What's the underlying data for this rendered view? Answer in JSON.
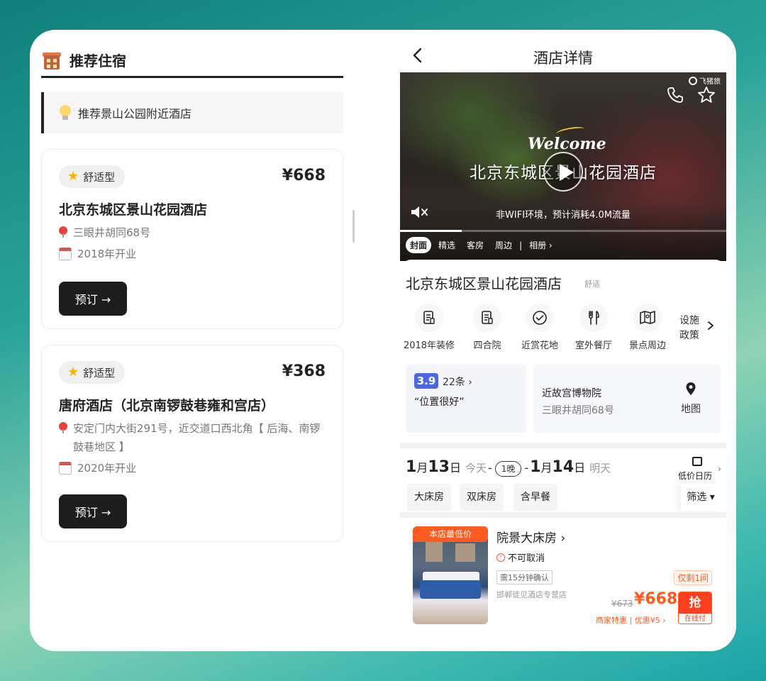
{
  "left": {
    "title": "推荐住宿",
    "tip": "推荐景山公园附近酒店",
    "cards": [
      {
        "tag": "舒适型",
        "price": "¥668",
        "name": "北京东城区景山花园酒店",
        "address": "三眼井胡同68号",
        "opened": "2018年开业",
        "book": "预订 →"
      },
      {
        "tag": "舒适型",
        "price": "¥368",
        "name": "唐府酒店（北京南锣鼓巷雍和宫店）",
        "address": "安定门内大街291号，近交道口西北角【 后海、南锣鼓巷地区 】",
        "opened": "2020年开业",
        "book": "预订 →"
      }
    ]
  },
  "right": {
    "title": "酒店详情",
    "video": {
      "brand": "飞猪旅",
      "welcome": "Welcome",
      "overlay_name": "北京东城区景山花园酒店",
      "wifi_note": "非WIFI环境，预计消耗4.0M流量",
      "progress": 0.19,
      "tabs": [
        "封面",
        "精选",
        "客房",
        "周边"
      ],
      "album": "相册 ›"
    },
    "hotel_name": "北京东城区景山花园酒店",
    "level": "舒适",
    "facilities": [
      "2018年装修",
      "四合院",
      "近赏花地",
      "室外餐厅",
      "景点周边"
    ],
    "policy": "设施政策",
    "review": {
      "score": "3.9",
      "count": "22条 ›",
      "quote": "“位置很好”"
    },
    "location": {
      "name": "近故宫博物院",
      "address": "三眼井胡同68号",
      "map": "地图"
    },
    "dates": {
      "checkin_month": "1",
      "checkin_day": "13",
      "checkin_label": "今天",
      "nights": "1晚",
      "checkout_month": "1",
      "checkout_day": "14",
      "checkout_label": "明天",
      "month_unit": "月",
      "day_unit": "日",
      "calendar": "低价日历"
    },
    "chips": [
      "大床房",
      "双床房",
      "含早餐"
    ],
    "filter": "筛选 ▾",
    "room": {
      "tag": "本店最低价",
      "name": "院景大床房 ›",
      "cancel": "不可取消",
      "confirm": "需15分钟确认",
      "seller": "邯郸徒见酒店专营店",
      "left_only": "仅剩1间",
      "orig_price": "¥673",
      "price": "¥668",
      "discount": "商家特惠 | 优惠¥5 ›",
      "grab": "抢",
      "grab_sub": "在线付"
    }
  },
  "colors": {
    "accent": "#ff5a1f",
    "score_blue": "#4a68e3",
    "dark_button": "#1d1d1d"
  }
}
